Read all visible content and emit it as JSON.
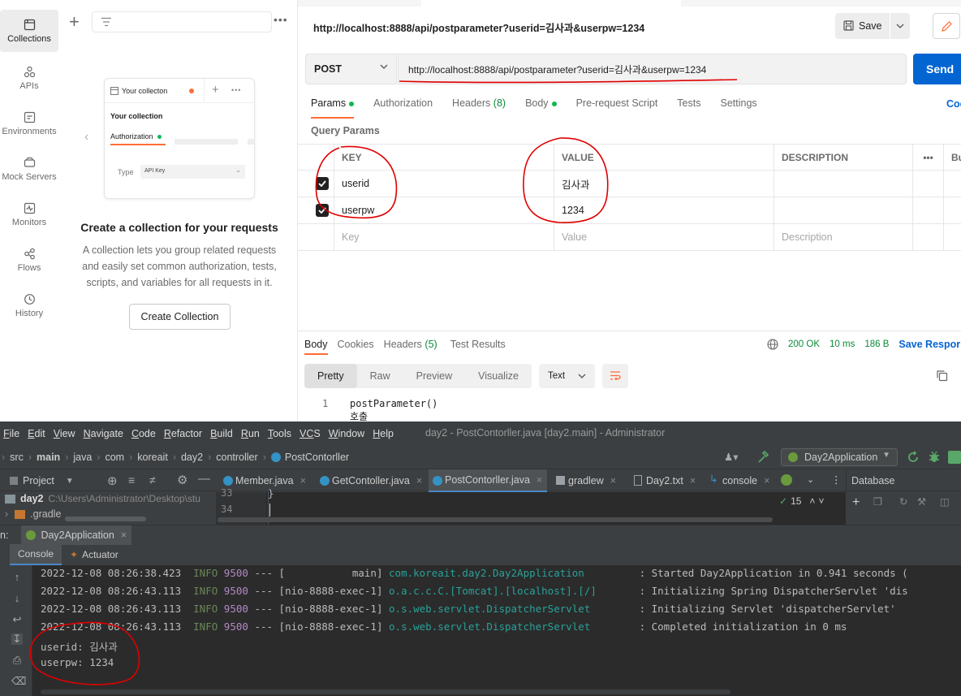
{
  "postman": {
    "nav": [
      {
        "label": "Collections",
        "icon": "collections-icon"
      },
      {
        "label": "APIs",
        "icon": "apis-icon"
      },
      {
        "label": "Environments",
        "icon": "environments-icon"
      },
      {
        "label": "Mock Servers",
        "icon": "mock-servers-icon"
      },
      {
        "label": "Monitors",
        "icon": "monitors-icon"
      },
      {
        "label": "Flows",
        "icon": "flows-icon"
      },
      {
        "label": "History",
        "icon": "history-icon"
      }
    ],
    "sidebar": {
      "illustration": {
        "tab_label": "Your collecton",
        "collection_label": "Your collection",
        "auth_label": "Authorization",
        "type_label": "Type",
        "type_value": "API Key"
      },
      "empty_title": "Create a collection for your requests",
      "empty_desc": "A collection lets you group related requests and easily set common authorization, tests, scripts, and variables for all requests in it.",
      "create_button": "Create Collection"
    },
    "request": {
      "title": "http://localhost:8888/api/postparameter?userid=김사과&userpw=1234",
      "save_label": "Save",
      "method": "POST",
      "url": "http://localhost:8888/api/postparameter?userid=김사과&userpw=1234",
      "send_label": "Send",
      "tabs": {
        "params": "Params",
        "authorization": "Authorization",
        "headers": "Headers",
        "headers_count": "(8)",
        "body": "Body",
        "prerequest": "Pre-request Script",
        "tests": "Tests",
        "settings": "Settings"
      },
      "cookies_label": "Coo",
      "query_params_label": "Query Params",
      "columns": {
        "key": "KEY",
        "value": "VALUE",
        "description": "DESCRIPTION",
        "more": "•••",
        "bulk": "Bu"
      },
      "params": [
        {
          "key": "userid",
          "value": "김사과"
        },
        {
          "key": "userpw",
          "value": "1234"
        }
      ],
      "placeholders": {
        "key": "Key",
        "value": "Value",
        "description": "Description"
      }
    },
    "response": {
      "tabs": {
        "body": "Body",
        "cookies": "Cookies",
        "headers": "Headers",
        "headers_count": "(5)",
        "test_results": "Test Results"
      },
      "status": "200 OK",
      "time": "10 ms",
      "size": "186 B",
      "save_label": "Save Respor",
      "formats": [
        "Pretty",
        "Raw",
        "Preview",
        "Visualize"
      ],
      "text_type": "Text",
      "lines": [
        {
          "no": "1",
          "code": "postParameter() 호출"
        }
      ]
    }
  },
  "intellij": {
    "menu": [
      {
        "first": "F",
        "rest": "ile"
      },
      {
        "first": "E",
        "rest": "dit"
      },
      {
        "first": "V",
        "rest": "iew"
      },
      {
        "first": "N",
        "rest": "avigate"
      },
      {
        "first": "C",
        "rest": "ode"
      },
      {
        "first": "R",
        "rest": "efactor"
      },
      {
        "first": "B",
        "rest": "uild"
      },
      {
        "first": "R",
        "rest": "un"
      },
      {
        "first": "T",
        "rest": "ools"
      },
      {
        "first": "VC",
        "rest": "S"
      },
      {
        "first": "W",
        "rest": "indow"
      },
      {
        "first": "H",
        "rest": "elp"
      }
    ],
    "window_title": "day2 - PostContorller.java [day2.main] - Administrator",
    "breadcrumbs": [
      "src",
      "main",
      "java",
      "com",
      "koreait",
      "day2",
      "controller",
      "PostContorller"
    ],
    "run_config": "Day2Application",
    "project_tab": "Project",
    "editor_tabs": [
      "Member.java",
      "GetContoller.java",
      "PostContorller.java",
      "gradlew",
      "Day2.txt",
      "console"
    ],
    "database_tab": "Database",
    "project_root": "day2",
    "project_path": "C:\\Users\\Administrator\\Desktop\\stu",
    "project_child": ".gradle",
    "gutter_lines": [
      "33",
      "34"
    ],
    "code_line_33": "}",
    "warnings_count": "15",
    "run_label": "n:",
    "run_tab": "Day2Application",
    "console_tabs": {
      "console": "Console",
      "actuator": "Actuator"
    },
    "logs": [
      {
        "ts": "2022-12-08 08:26:38.423",
        "level": "INFO",
        "pid": "9500",
        "thread": "--- [           main]",
        "logger": "com.koreait.day2.Day2Application        ",
        "msg": ": Started Day2Application in 0.941 seconds ("
      },
      {
        "ts": "2022-12-08 08:26:43.113",
        "level": "INFO",
        "pid": "9500",
        "thread": "--- [nio-8888-exec-1]",
        "logger": "o.a.c.c.C.[Tomcat].[localhost].[/]      ",
        "msg": ": Initializing Spring DispatcherServlet 'dis"
      },
      {
        "ts": "2022-12-08 08:26:43.113",
        "level": "INFO",
        "pid": "9500",
        "thread": "--- [nio-8888-exec-1]",
        "logger": "o.s.web.servlet.DispatcherServlet       ",
        "msg": ": Initializing Servlet 'dispatcherServlet'"
      },
      {
        "ts": "2022-12-08 08:26:43.113",
        "level": "INFO",
        "pid": "9500",
        "thread": "--- [nio-8888-exec-1]",
        "logger": "o.s.web.servlet.DispatcherServlet       ",
        "msg": ": Completed initialization in 0 ms"
      }
    ],
    "output_lines": [
      "userid: 김사과",
      "userpw: 1234"
    ]
  },
  "annotation_color": "#e00000",
  "accent_send": "#0265d2",
  "accent_tab": "#ff6c37"
}
